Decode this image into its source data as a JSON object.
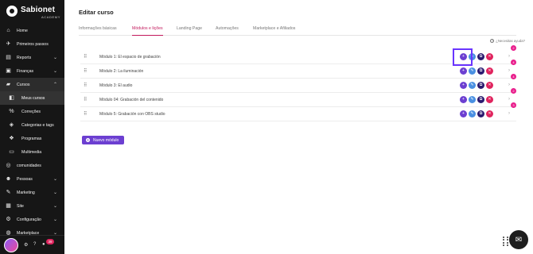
{
  "brand": {
    "name": "Sabionet",
    "sub": "ACADEMY"
  },
  "sidebar": {
    "items": [
      {
        "label": "Home",
        "icon": "home-icon",
        "glyph": "⌂",
        "chevron": false
      },
      {
        "label": "Primeiros passos",
        "icon": "rocket-icon",
        "glyph": "✈",
        "chevron": false
      },
      {
        "label": "Reports",
        "icon": "chart-icon",
        "glyph": "▤",
        "chevron": true
      },
      {
        "label": "Finanças",
        "icon": "wallet-icon",
        "glyph": "▣",
        "chevron": true
      },
      {
        "label": "Cursos",
        "icon": "courses-icon",
        "glyph": "▰",
        "chevron": true,
        "expanded": true
      },
      {
        "label": "Meus cursos",
        "icon": "my-courses-icon",
        "glyph": "◧",
        "sub": true,
        "current": true
      },
      {
        "label": "Correções",
        "icon": "percent-icon",
        "glyph": "%",
        "sub": true
      },
      {
        "label": "Categorias e tags",
        "icon": "tag-icon",
        "glyph": "◈",
        "sub": true
      },
      {
        "label": "Programas",
        "icon": "program-icon",
        "glyph": "❖",
        "sub": true
      },
      {
        "label": "Multimedia",
        "icon": "monitor-icon",
        "glyph": "▭",
        "sub": true
      },
      {
        "label": "comunidades",
        "icon": "community-icon",
        "glyph": "◎",
        "chevron": false
      },
      {
        "label": "Pessoas",
        "icon": "people-icon",
        "glyph": "☻",
        "chevron": true
      },
      {
        "label": "Marketing",
        "icon": "megaphone-icon",
        "glyph": "✎",
        "chevron": true
      },
      {
        "label": "Site",
        "icon": "site-icon",
        "glyph": "▦",
        "chevron": true
      },
      {
        "label": "Configuração",
        "icon": "settings-icon",
        "glyph": "⚙",
        "chevron": true
      },
      {
        "label": "Marketplace",
        "icon": "marketplace-icon",
        "glyph": "◍",
        "chevron": true
      }
    ],
    "footer": {
      "notifications": "39"
    }
  },
  "page": {
    "title": "Editar curso"
  },
  "tabs": [
    {
      "label": "Informações básicas",
      "active": false
    },
    {
      "label": "Módulos e lições",
      "active": true
    },
    {
      "label": "Landing Page",
      "active": false
    },
    {
      "label": "Automações",
      "active": false
    },
    {
      "label": "Marketplace e Afiliados",
      "active": false
    }
  ],
  "help": {
    "label": "¿Necesitas ayuda?"
  },
  "modules": [
    {
      "label": "Módulo 1: El espacio de grabación",
      "count": "2"
    },
    {
      "label": "Módulo 2: La iluminación",
      "count": "4"
    },
    {
      "label": "Módulo 3: El audio",
      "count": "4"
    },
    {
      "label": "Módulo 04: Grabación del contenido",
      "count": "2"
    },
    {
      "label": "Módulo 5: Grabación con OBS studio",
      "count": "3"
    }
  ],
  "actions": {
    "add": {
      "icon": "plus-icon",
      "glyph": "+"
    },
    "edit": {
      "icon": "pencil-icon",
      "glyph": "✎"
    },
    "copy": {
      "icon": "copy-icon",
      "glyph": "⧉"
    },
    "delete": {
      "icon": "trash-icon",
      "glyph": "✕"
    }
  },
  "new_module_button": {
    "label": "Nuevo módulo"
  },
  "colors": {
    "accent": "#6c3fd1",
    "active_tab": "#c2185b",
    "badge": "#e91e8c",
    "sidebar": "#161616"
  }
}
